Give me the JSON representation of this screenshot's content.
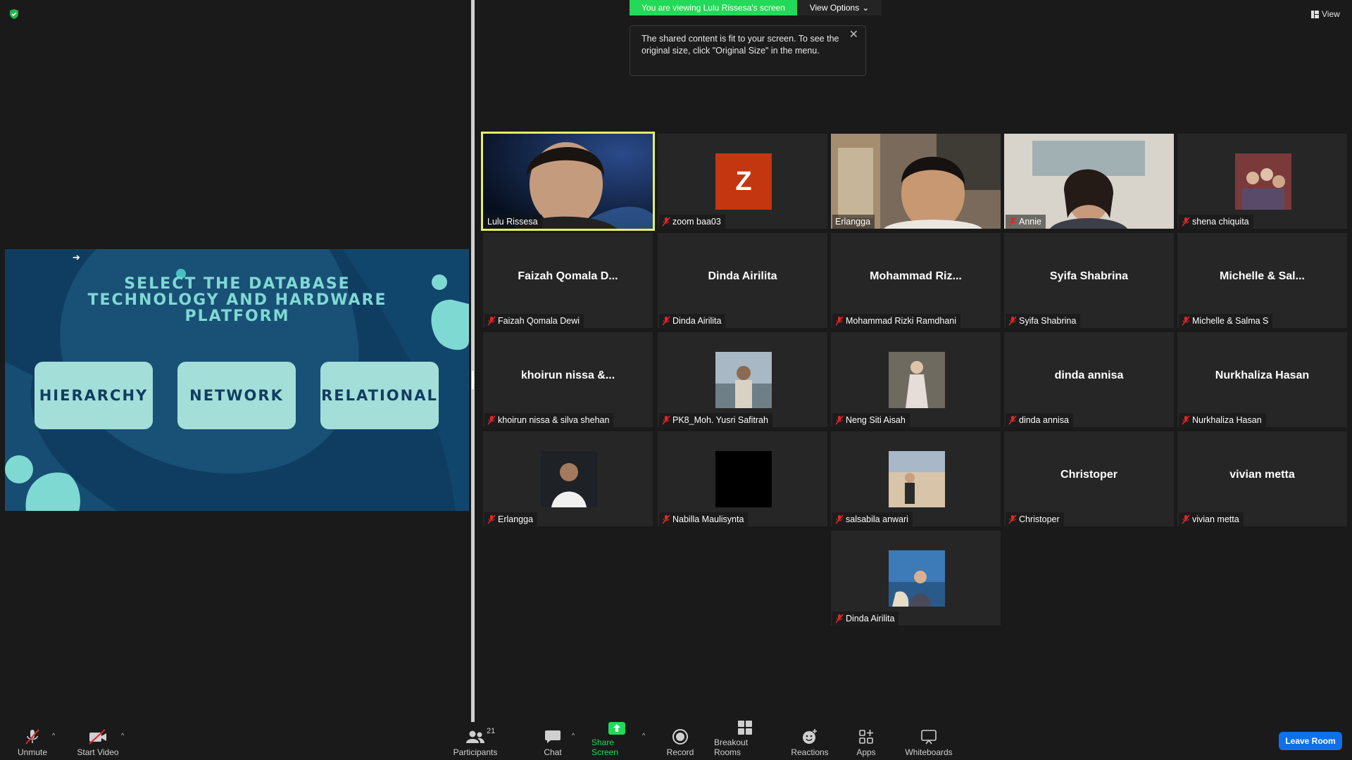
{
  "banner": {
    "viewing_text": "You are viewing Lulu Rissesa's screen",
    "view_options_label": "View Options",
    "tooltip_text": "The shared content is fit to your screen. To see the original size, click \"Original Size\" in the menu.",
    "view_label": "View"
  },
  "slide": {
    "title_line1": "SELECT THE DATABASE",
    "title_line2": "TECHNOLOGY AND HARDWARE",
    "title_line3": "PLATFORM",
    "buttons": [
      "HIERARCHY",
      "NETWORK",
      "RELATIONAL"
    ]
  },
  "participants": [
    {
      "label": "Lulu Rissesa",
      "display": "",
      "muted": false,
      "active": true,
      "media": "video"
    },
    {
      "label": "zoom baa03",
      "display": "",
      "muted": true,
      "avatar_letter": "Z",
      "avatar_color": "#c3360f",
      "media": "letter"
    },
    {
      "label": "Erlangga",
      "display": "",
      "muted": false,
      "media": "video"
    },
    {
      "label": "Annie",
      "display": "",
      "muted": true,
      "media": "video"
    },
    {
      "label": "shena chiquita",
      "display": "",
      "muted": true,
      "media": "photo",
      "photo_color": "#7a3a3a"
    },
    {
      "label": "Faizah Qomala Dewi",
      "display": "Faizah Qomala D...",
      "muted": true,
      "media": "name"
    },
    {
      "label": "Dinda Airilita",
      "display": "Dinda Airilita",
      "muted": true,
      "media": "name"
    },
    {
      "label": "Mohammad Rizki Ramdhani",
      "display": "Mohammad  Riz...",
      "muted": true,
      "media": "name"
    },
    {
      "label": "Syifa Shabrina",
      "display": "Syifa Shabrina",
      "muted": true,
      "media": "name"
    },
    {
      "label": "Michelle  & Salma S",
      "display": "Michelle  & Sal...",
      "muted": true,
      "media": "name"
    },
    {
      "label": "khoirun nissa & silva shehan",
      "display": "khoirun nissa &...",
      "muted": true,
      "media": "name"
    },
    {
      "label": "PK8_Moh. Yusri Safitrah",
      "display": "",
      "muted": true,
      "media": "photo",
      "photo_color": "#8a9aa8"
    },
    {
      "label": "Neng Siti Aisah",
      "display": "",
      "muted": true,
      "media": "photo",
      "photo_color": "#9b8a78"
    },
    {
      "label": "dinda annisa",
      "display": "dinda annisa",
      "muted": true,
      "media": "name"
    },
    {
      "label": "Nurkhaliza Hasan",
      "display": "Nurkhaliza Hasan",
      "muted": true,
      "media": "name"
    },
    {
      "label": "Erlangga",
      "display": "",
      "muted": true,
      "media": "photo",
      "photo_color": "#2a2f36"
    },
    {
      "label": "Nabilla Maulisynta",
      "display": "",
      "muted": true,
      "media": "photo",
      "photo_color": "#000000"
    },
    {
      "label": "salsabila anwari",
      "display": "",
      "muted": true,
      "media": "photo",
      "photo_color": "#b89a78"
    },
    {
      "label": "Christoper",
      "display": "Christoper",
      "muted": true,
      "media": "name"
    },
    {
      "label": "vivian metta",
      "display": "vivian metta",
      "muted": true,
      "media": "name"
    },
    {
      "label": "Dinda Airilita",
      "display": "",
      "muted": true,
      "media": "photo",
      "photo_color": "#3c7ab8"
    }
  ],
  "toolbar": {
    "unmute": "Unmute",
    "start_video": "Start Video",
    "participants": "Participants",
    "participants_count": "21",
    "chat": "Chat",
    "share_screen": "Share Screen",
    "record": "Record",
    "breakout_rooms": "Breakout Rooms",
    "reactions": "Reactions",
    "apps": "Apps",
    "whiteboards": "Whiteboards",
    "leave_room": "Leave Room"
  },
  "colors": {
    "active_speaker_border": "#e6f064",
    "banner_green": "#23d959",
    "share_green": "#23d959",
    "leave_blue": "#0e71eb",
    "mute_red": "#e02828"
  }
}
